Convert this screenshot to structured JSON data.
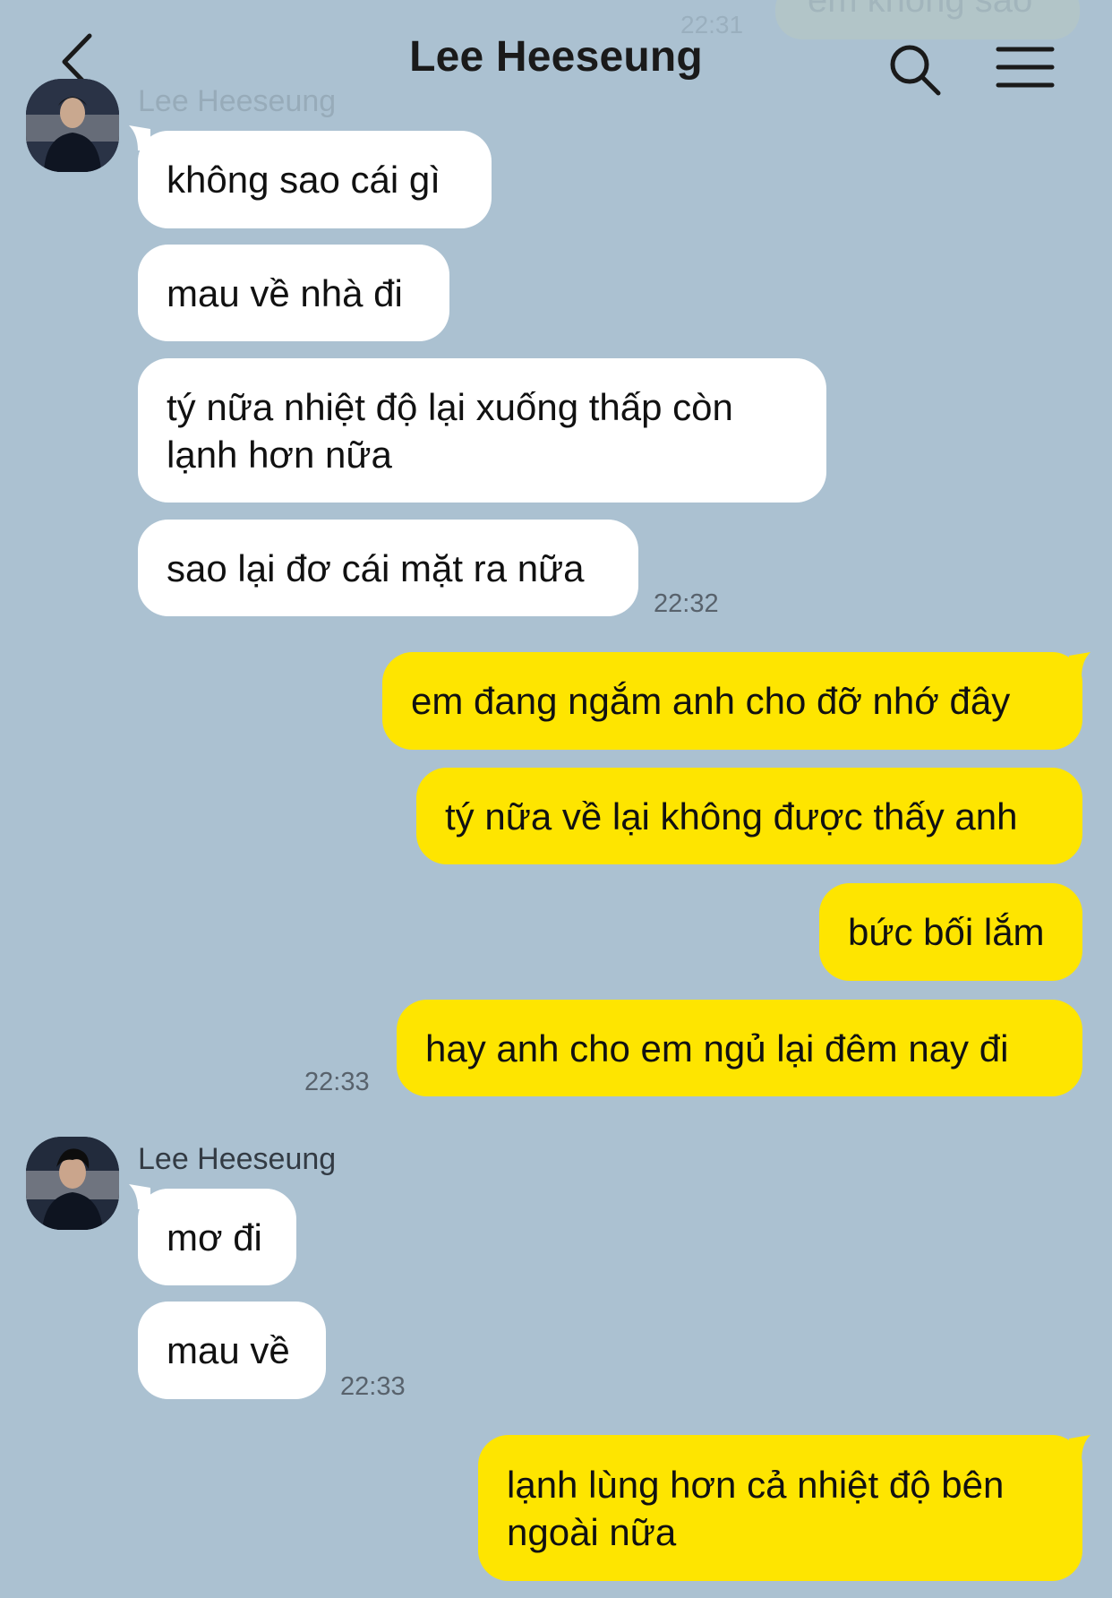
{
  "header": {
    "title": "Lee Heeseung",
    "back_icon": "chevron-left-icon",
    "search_icon": "search-icon",
    "menu_icon": "hamburger-menu-icon"
  },
  "faded_top": {
    "time": "22:31",
    "bubble_text": "em không sao",
    "sender_name": "Lee Heeseung"
  },
  "colors": {
    "background": "#abc1d1",
    "incoming_bubble": "#ffffff",
    "outgoing_bubble": "#fee500"
  },
  "messages": [
    {
      "side": "incoming",
      "text": "không sao cái gì"
    },
    {
      "side": "incoming",
      "text": "mau về nhà đi"
    },
    {
      "side": "incoming",
      "text": "tý nữa nhiệt độ lại xuống thấp còn lạnh hơn nữa"
    },
    {
      "side": "incoming",
      "text": "sao lại đơ cái mặt ra nữa",
      "time": "22:32"
    },
    {
      "side": "outgoing",
      "text": "em đang ngắm anh cho đỡ nhớ đây"
    },
    {
      "side": "outgoing",
      "text": "tý nữa về lại không được thấy anh"
    },
    {
      "side": "outgoing",
      "text": "bức bối lắm"
    },
    {
      "side": "outgoing",
      "text": "hay anh cho em ngủ lại đêm nay đi",
      "time": "22:33"
    },
    {
      "side": "incoming",
      "sender": "Lee Heeseung",
      "text": "mơ đi"
    },
    {
      "side": "incoming",
      "text": "mau về",
      "time": "22:33"
    },
    {
      "side": "outgoing",
      "text": "lạnh lùng hơn cả nhiệt độ bên ngoài nữa"
    }
  ]
}
